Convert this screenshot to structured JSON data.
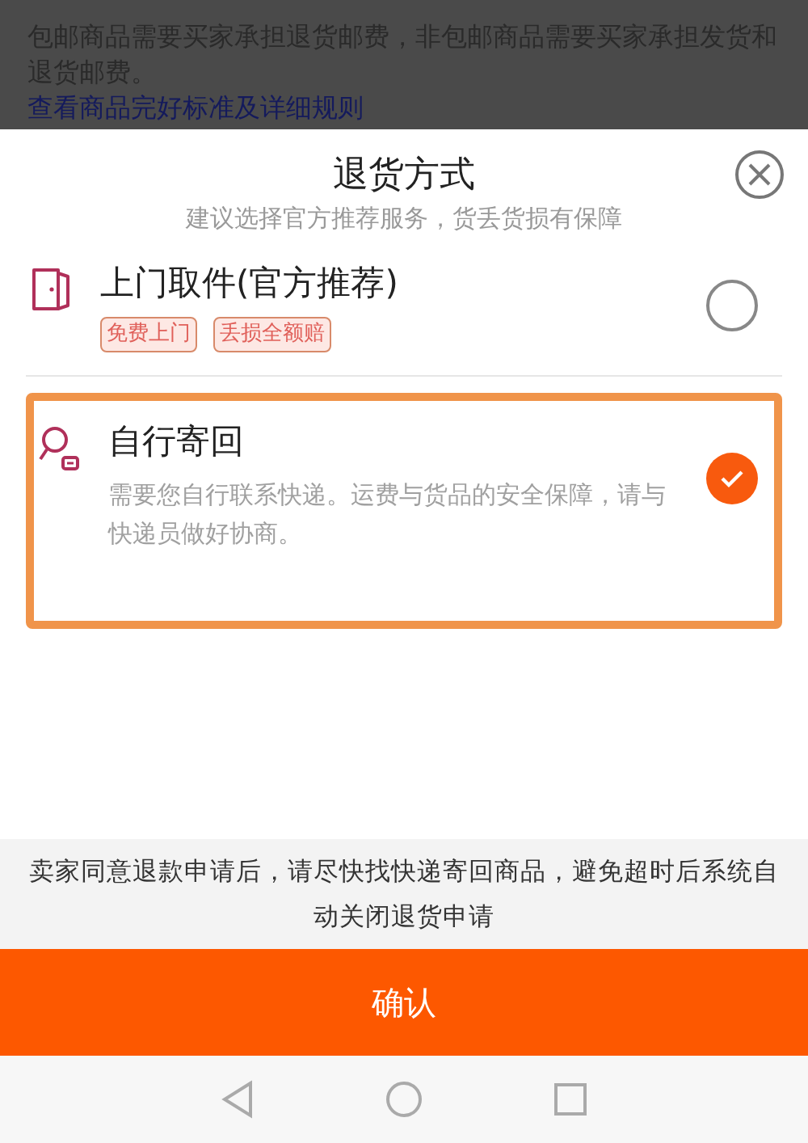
{
  "background": {
    "lines": [
      "包邮商品需要买家承担退货邮费，非包邮商品需要买家承担发货和退货邮费。"
    ],
    "link": "查看商品完好标准及详细规则"
  },
  "sheet": {
    "title": "退货方式",
    "subtitle": "建议选择官方推荐服务，货丢货损有保障",
    "options": [
      {
        "kind": "pickup",
        "title": "上门取件(官方推荐)",
        "tags": [
          "免费上门",
          "丢损全额赔"
        ],
        "selected": false,
        "highlighted": false
      },
      {
        "kind": "self",
        "title": "自行寄回",
        "description": "需要您自行联系快递。运费与货品的安全保障，请与快递员做好协商。",
        "selected": true,
        "highlighted": true
      }
    ],
    "notice": "卖家同意退款申请后，请尽快找快递寄回商品，避免超时后系统自动关闭退货申请",
    "confirm": "确认"
  }
}
